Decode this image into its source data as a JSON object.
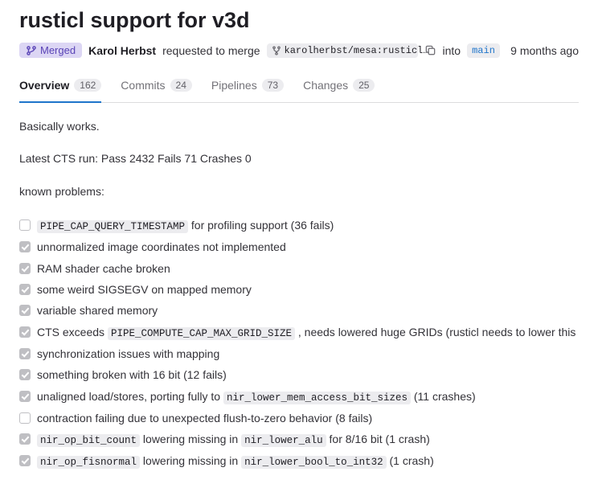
{
  "title": "rusticl support for v3d",
  "status": {
    "label": "Merged"
  },
  "author": "Karol Herbst",
  "requested": "requested to merge",
  "source_branch": "karolherbst/mesa:rusticl…",
  "into": "into",
  "target_branch": "main",
  "time": "9 months ago",
  "tabs": [
    {
      "label": "Overview",
      "count": "162",
      "active": true
    },
    {
      "label": "Commits",
      "count": "24",
      "active": false
    },
    {
      "label": "Pipelines",
      "count": "73",
      "active": false
    },
    {
      "label": "Changes",
      "count": "25",
      "active": false
    }
  ],
  "body": {
    "p1": "Basically works.",
    "p2": "Latest CTS run: Pass 2432 Fails 71 Crashes 0",
    "p3": "known problems:"
  },
  "tasks": [
    {
      "done": false,
      "parts": [
        {
          "t": "code",
          "v": "PIPE_CAP_QUERY_TIMESTAMP"
        },
        {
          "t": "text",
          "v": " for profiling support (36 fails)"
        }
      ]
    },
    {
      "done": true,
      "parts": [
        {
          "t": "text",
          "v": "unnormalized image coordinates not implemented"
        }
      ]
    },
    {
      "done": true,
      "parts": [
        {
          "t": "text",
          "v": "RAM shader cache broken"
        }
      ]
    },
    {
      "done": true,
      "parts": [
        {
          "t": "text",
          "v": "some weird SIGSEGV on mapped memory"
        }
      ]
    },
    {
      "done": true,
      "parts": [
        {
          "t": "text",
          "v": "variable shared memory"
        }
      ]
    },
    {
      "done": true,
      "parts": [
        {
          "t": "text",
          "v": "CTS exceeds "
        },
        {
          "t": "code",
          "v": "PIPE_COMPUTE_CAP_MAX_GRID_SIZE"
        },
        {
          "t": "text",
          "v": " , needs lowered huge GRIDs (rusticl needs to lower this"
        }
      ]
    },
    {
      "done": true,
      "parts": [
        {
          "t": "text",
          "v": "synchronization issues with mapping"
        }
      ]
    },
    {
      "done": true,
      "parts": [
        {
          "t": "text",
          "v": "something broken with 16 bit (12 fails)"
        }
      ]
    },
    {
      "done": true,
      "parts": [
        {
          "t": "text",
          "v": "unaligned load/stores, porting fully to "
        },
        {
          "t": "code",
          "v": "nir_lower_mem_access_bit_sizes"
        },
        {
          "t": "text",
          "v": " (11 crashes)"
        }
      ]
    },
    {
      "done": false,
      "parts": [
        {
          "t": "text",
          "v": "contraction failing due to unexpected flush-to-zero behavior (8 fails)"
        }
      ]
    },
    {
      "done": true,
      "parts": [
        {
          "t": "code",
          "v": "nir_op_bit_count"
        },
        {
          "t": "text",
          "v": " lowering missing in "
        },
        {
          "t": "code",
          "v": "nir_lower_alu"
        },
        {
          "t": "text",
          "v": " for 8/16 bit (1 crash)"
        }
      ]
    },
    {
      "done": true,
      "parts": [
        {
          "t": "code",
          "v": "nir_op_fisnormal"
        },
        {
          "t": "text",
          "v": " lowering missing in "
        },
        {
          "t": "code",
          "v": "nir_lower_bool_to_int32"
        },
        {
          "t": "text",
          "v": " (1 crash)"
        }
      ]
    }
  ]
}
